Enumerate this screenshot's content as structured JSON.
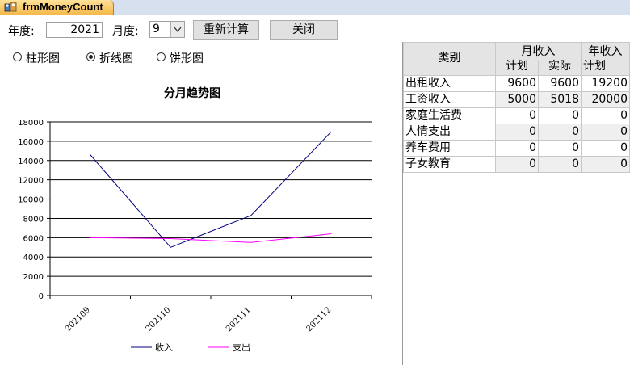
{
  "window": {
    "title": "frmMoneyCount"
  },
  "controls": {
    "year_label": "年度:",
    "year_value": "2021",
    "month_label": "月度:",
    "month_value": "9",
    "recalc_button": "重新计算",
    "close_button": "关闭"
  },
  "chart_options": [
    {
      "label": "柱形图",
      "selected": false
    },
    {
      "label": "折线图",
      "selected": true
    },
    {
      "label": "饼形图",
      "selected": false
    }
  ],
  "chart_data": {
    "type": "line",
    "title": "分月趋势图",
    "categories": [
      "202109",
      "202110",
      "202111",
      "202112"
    ],
    "ylim": [
      0,
      18000
    ],
    "yticks": [
      0,
      2000,
      4000,
      6000,
      8000,
      10000,
      12000,
      14000,
      16000,
      18000
    ],
    "series": [
      {
        "name": "收入",
        "color": "#000080",
        "values": [
          14600,
          5000,
          8300,
          17000
        ]
      },
      {
        "name": "支出",
        "color": "#ff00ff",
        "values": [
          6000,
          5900,
          5500,
          6400
        ]
      }
    ],
    "grid": true,
    "legend": "bottom"
  },
  "table": {
    "header": {
      "category": "类别",
      "month_group": "月收入",
      "year_group": "年收入",
      "plan": "计划",
      "actual": "实际",
      "year_plan": "计划"
    },
    "rows": [
      {
        "category": "出租收入",
        "plan": "9600",
        "actual": "9600",
        "year_plan": "19200"
      },
      {
        "category": "工资收入",
        "plan": "5000",
        "actual": "5018",
        "year_plan": "20000"
      },
      {
        "category": "家庭生活费",
        "plan": "0",
        "actual": "0",
        "year_plan": "0"
      },
      {
        "category": "人情支出",
        "plan": "0",
        "actual": "0",
        "year_plan": "0"
      },
      {
        "category": "养车费用",
        "plan": "0",
        "actual": "0",
        "year_plan": "0"
      },
      {
        "category": "子女教育",
        "plan": "0",
        "actual": "0",
        "year_plan": "0"
      }
    ]
  }
}
